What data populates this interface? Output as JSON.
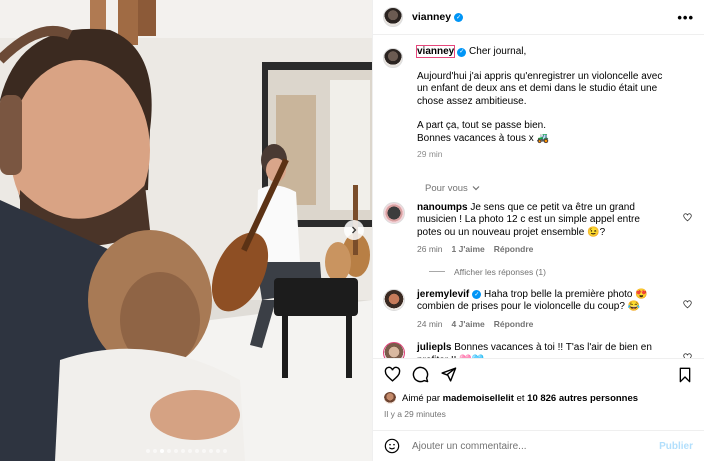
{
  "post": {
    "username": "vianney",
    "verified": true,
    "carousel": {
      "slide_count": 12,
      "active_slide": 3
    }
  },
  "caption": {
    "username": "vianney",
    "lines": [
      "Cher journal,",
      "Aujourd'hui j'ai appris qu'enregistrer un violoncelle avec un enfant de deux ans et demi dans le studio était une chose assez ambitieuse.",
      "A part ça, tout se passe bien.",
      "Bonnes vacances à tous x 🚜"
    ],
    "time": "29 min"
  },
  "filter": {
    "label": "Pour vous"
  },
  "comments": [
    {
      "username": "nanoumps",
      "text": "Je sens que ce petit va être un grand musicien ! La photo 12 c est un simple appel entre potes ou un nouveau projet ensemble 😉?",
      "time": "26 min",
      "likes": "1 J'aime",
      "reply": "Répondre"
    },
    {
      "username": "jeremylevif",
      "verified": true,
      "text": "Haha trop belle la première photo 😍 combien de prises pour le violoncelle du coup? 😂",
      "time": "24 min",
      "likes": "4 J'aime",
      "reply": "Répondre"
    },
    {
      "username": "juliepls",
      "text": "Bonnes vacances à toi !! T'as l'air de bien en profiter !! 🩷🩵"
    }
  ],
  "show_replies": "Afficher les réponses (1)",
  "likes": {
    "prefix": "Aimé par",
    "first_liker": "mademoisellelit",
    "connector": "et",
    "others": "10 826 autres personnes"
  },
  "post_time": "Il y a 29 minutes",
  "add_comment": {
    "placeholder": "Ajouter un commentaire...",
    "publish": "Publier"
  },
  "icons": {
    "like": "heart-icon",
    "comment": "comment-icon",
    "share": "paper-plane-icon",
    "save": "bookmark-icon",
    "emoji": "smiley-icon",
    "more": "more-options-icon"
  },
  "colors": {
    "verified": "#0095f6",
    "muted": "#737373",
    "publish": "#b2dffc"
  }
}
